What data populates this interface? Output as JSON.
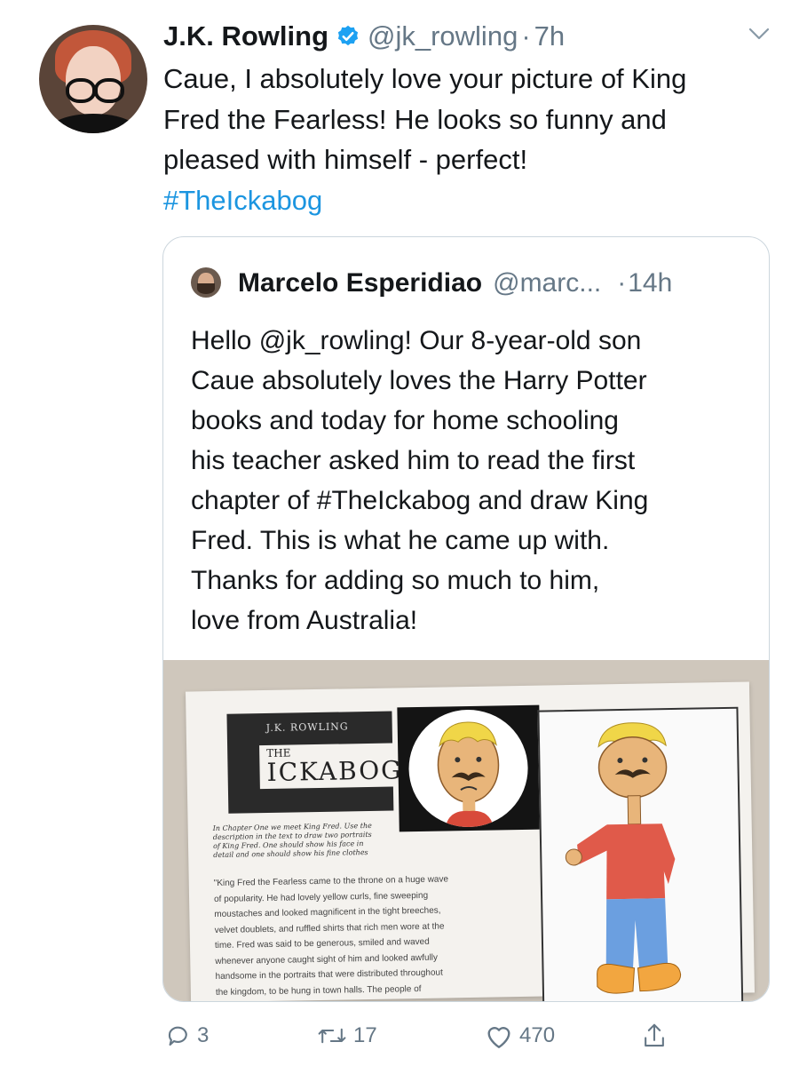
{
  "tweet": {
    "author_name": "J.K. Rowling",
    "handle": "@jk_rowling",
    "separator": "·",
    "time": "7h",
    "text_lines": [
      "Caue, I absolutely love your picture of King",
      "Fred the Fearless! He looks so funny and",
      "pleased with himself - perfect!"
    ],
    "hashtag": "#TheIckabog",
    "accent_color": "#1b95e0"
  },
  "quoted": {
    "author_name": "Marcelo Esperidiao",
    "handle": "@marc...",
    "separator": "·",
    "time": "14h",
    "text_lines": [
      "Hello @jk_rowling! Our 8-year-old son",
      "Caue absolutely loves the Harry Potter",
      "books and today for home schooling",
      "his teacher asked him to read the first",
      "chapter of #TheIckabog and draw King",
      "Fred. This is what he came up with.",
      "Thanks for adding so much to him,",
      "love from Australia!"
    ]
  },
  "photo": {
    "author": "J.K. ROWLING",
    "title_small": "THE",
    "title_big": "ICKABOG",
    "instructions": "In Chapter One we meet King Fred. Use the description in the text to draw two portraits of King Fred. One should show his face in detail and one should show his fine clothes",
    "excerpt_lines": [
      "\"King Fred the Fearless came to the throne on a huge wave",
      "of popularity. He had lovely yellow curls, fine sweeping",
      "moustaches and looked magnificent in the tight breeches,",
      "velvet doublets, and ruffled shirts that rich men wore at the",
      "time. Fred was said to be generous, smiled and waved",
      "whenever anyone caught sight of him and looked awfully",
      "handsome in the portraits that were distributed throughout",
      "the kingdom, to be hung in town halls. The people of"
    ]
  },
  "actions": {
    "replies": "3",
    "retweets": "17",
    "likes": "470",
    "reply_icon": "reply-icon",
    "retweet_icon": "retweet-icon",
    "like_icon": "heart-icon",
    "share_icon": "share-icon"
  }
}
